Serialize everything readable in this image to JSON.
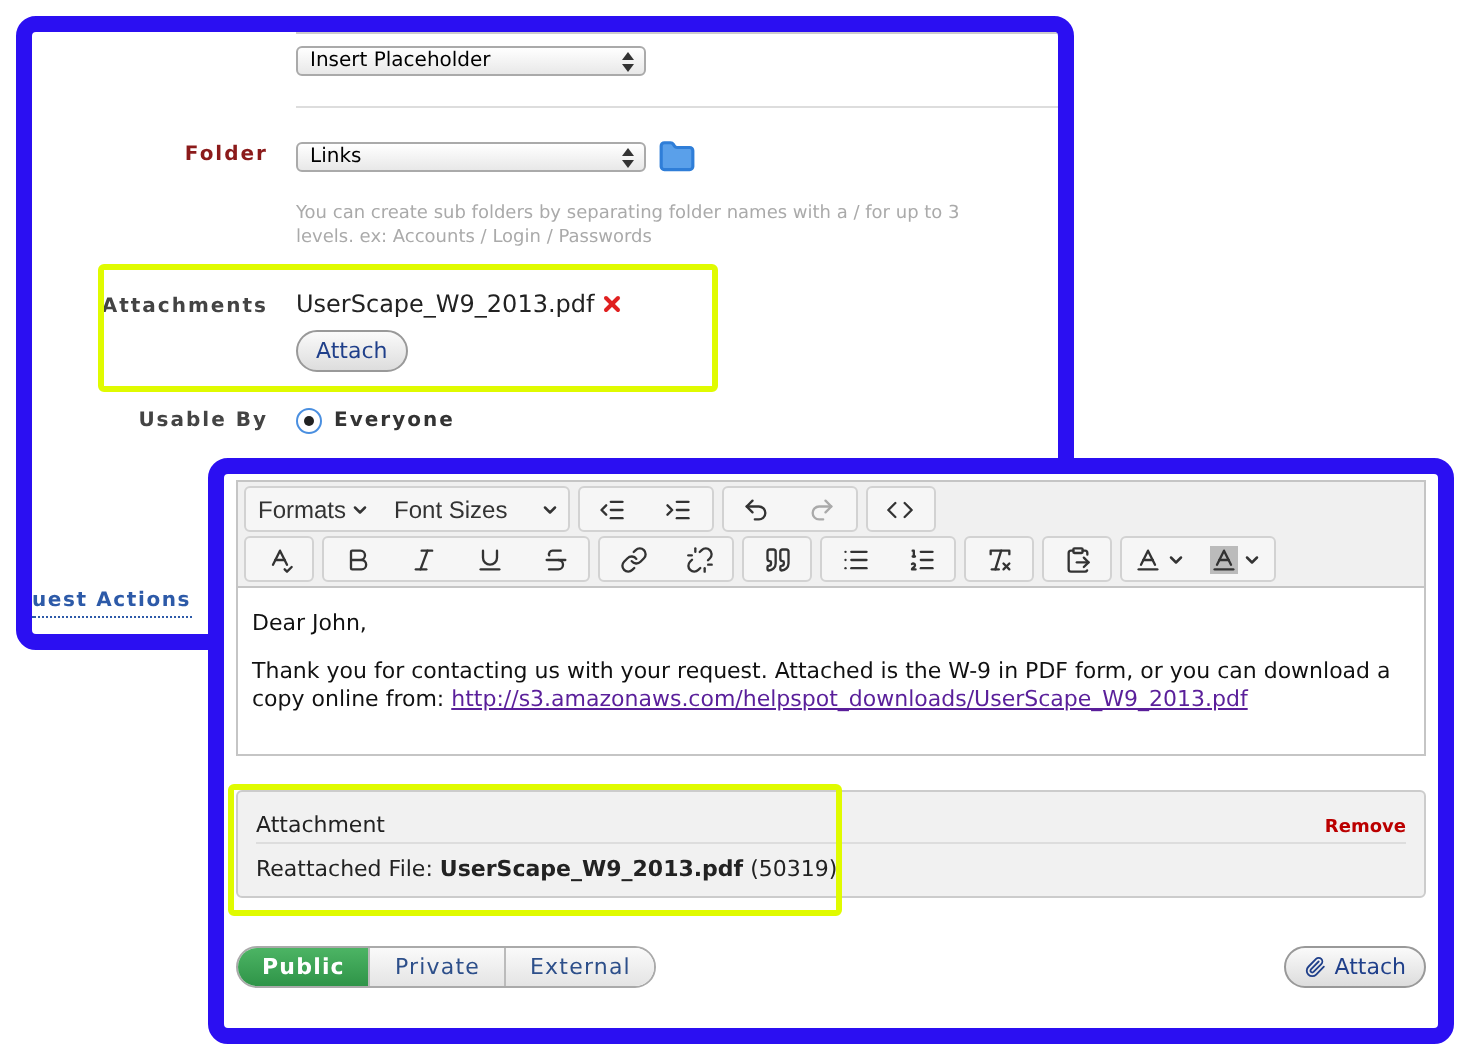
{
  "back_panel": {
    "placeholder_select": "Insert Placeholder",
    "folder": {
      "label": "Folder",
      "value": "Links",
      "help": "You can create sub folders by separating folder names with a / for up to 3 levels. ex: Accounts / Login / Passwords"
    },
    "attachments": {
      "label": "Attachments",
      "file": "UserScape_W9_2013.pdf",
      "button": "Attach"
    },
    "usable_by": {
      "label": "Usable By",
      "options": [
        {
          "label": "Everyone",
          "selected": true
        }
      ]
    },
    "section_link": "uest Actions"
  },
  "front_panel": {
    "toolbar": {
      "formats": "Formats",
      "font_sizes": "Font Sizes",
      "redo_disabled": true
    },
    "body": {
      "greeting": "Dear John,",
      "paragraph": "Thank you for contacting us with your request.  Attached is the W-9 in PDF form, or you can download a copy online from:",
      "link": "http://s3.amazonaws.com/helpspot_downloads/UserScape_W9_2013.pdf"
    },
    "attachment": {
      "title": "Attachment",
      "remove": "Remove",
      "file_line": "Reattached File: **UserScape_W9_2013.pdf** (50319)"
    },
    "tabs": [
      {
        "label": "Public",
        "selected": true
      },
      {
        "label": "Private",
        "selected": false
      },
      {
        "label": "External",
        "selected": false
      }
    ],
    "attach_button": "Attach"
  }
}
